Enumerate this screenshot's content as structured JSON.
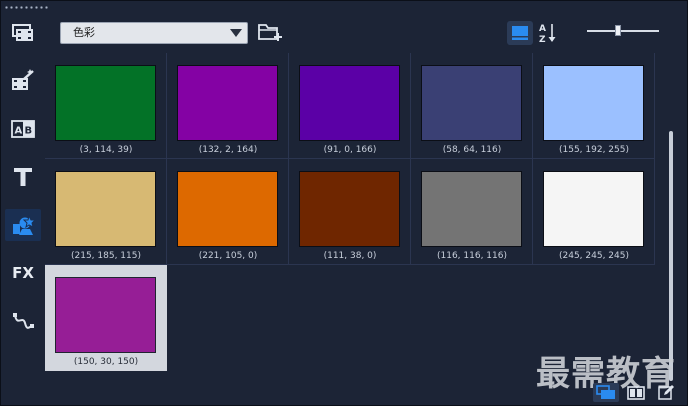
{
  "toolbar": {
    "category_selected": "色彩"
  },
  "swatches": [
    {
      "label": "(3, 114, 39)",
      "color": "#037227"
    },
    {
      "label": "(132, 2, 164)",
      "color": "#8402a4"
    },
    {
      "label": "(91, 0, 166)",
      "color": "#5b00a6"
    },
    {
      "label": "(58, 64, 116)",
      "color": "#3a4074"
    },
    {
      "label": "(155, 192, 255)",
      "color": "#9bc0ff"
    },
    {
      "label": "(215, 185, 115)",
      "color": "#d7b973"
    },
    {
      "label": "(221, 105, 0)",
      "color": "#dd6900"
    },
    {
      "label": "(111, 38, 0)",
      "color": "#6f2600"
    },
    {
      "label": "(116, 116, 116)",
      "color": "#747474"
    },
    {
      "label": "(245, 245, 245)",
      "color": "#f5f5f5"
    },
    {
      "label": "(150, 30, 150)",
      "color": "#961e96",
      "selected": true
    }
  ],
  "watermark": "最需教育",
  "sidebar": {
    "items": [
      {
        "icon": "media-library-icon"
      },
      {
        "icon": "instant-project-icon"
      },
      {
        "icon": "transition-icon"
      },
      {
        "icon": "title-icon"
      },
      {
        "icon": "graphics-icon",
        "active": true
      },
      {
        "icon": "filter-icon",
        "text": "FX"
      },
      {
        "icon": "path-icon"
      }
    ]
  },
  "colors": {
    "panel": "#1c2436",
    "accent": "#1e88e5",
    "selected_bg": "#d3d7de"
  }
}
